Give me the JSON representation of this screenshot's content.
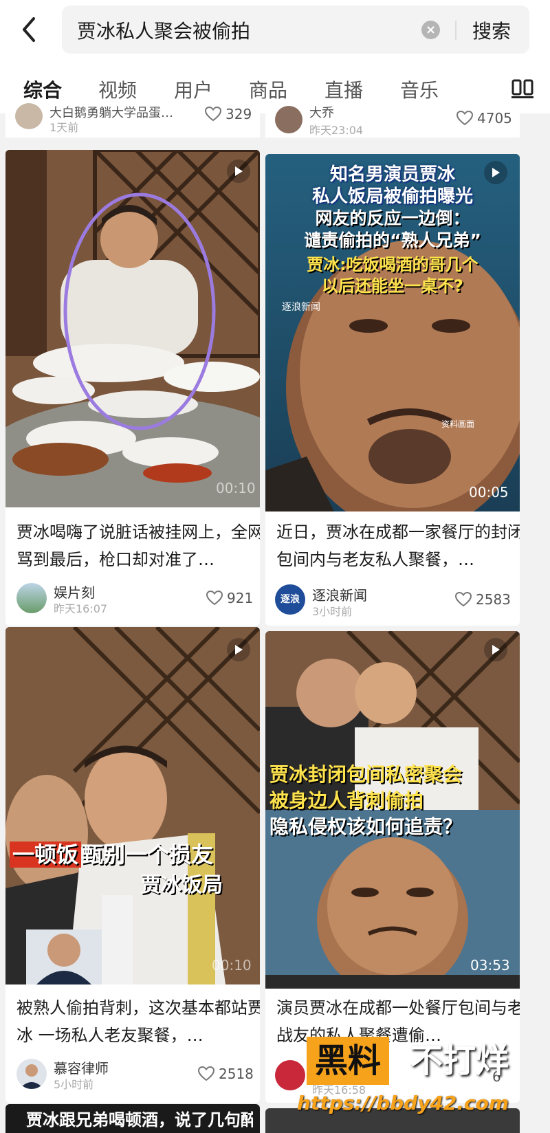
{
  "search": {
    "query": "贾冰私人聚会被偷拍",
    "button": "搜索"
  },
  "tabs": [
    "综合",
    "视频",
    "用户",
    "商品",
    "直播",
    "音乐"
  ],
  "top_partial": [
    {
      "title": "大白鹅勇躺大学品蛋…",
      "time": "1天前",
      "likes": "329"
    },
    {
      "author": "大乔",
      "time": "昨天23:04",
      "likes": "4705"
    }
  ],
  "cards": [
    {
      "duration": "00:10",
      "title": "贾冰喝嗨了说脏话被挂网上，全网骂到最后，枪口却对准了…",
      "author": "娱片刻",
      "time": "昨天16:07",
      "likes": "921"
    },
    {
      "duration": "00:05",
      "overlay": [
        "知名男演员贾冰",
        "私人饭局被偷拍曝光",
        "网友的反应一边倒：",
        "谴责偷拍的“熟人兄弟”",
        "贾冰:吃饭喝酒的哥几个",
        "以后还能坐一桌不?"
      ],
      "source_badge": "逐浪新闻",
      "source_note": "资料画面",
      "title": "近日，贾冰在成都一家餐厅的封闭包间内与老友私人聚餐，…",
      "author": "逐浪新闻",
      "avatar_text": "逐浪",
      "time": "3小时前",
      "likes": "2583"
    },
    {
      "duration": "00:10",
      "overlay": [
        "一顿饭",
        "甄别一个损友",
        "贾冰饭局"
      ],
      "title": "被熟人偷拍背刺，这次基本都站贾冰 一场私人老友聚餐，…",
      "author": "慕容律师",
      "time": "5小时前",
      "likes": "2518"
    },
    {
      "duration": "03:53",
      "overlay": [
        "贾冰封闭包间私密聚会",
        "被身边人背刺偷拍",
        "隐私侵权该如何追责？"
      ],
      "title": "演员贾冰在成都一处餐厅包间与老战友的私人聚餐遭偷…",
      "author": "",
      "time": "昨天16:58",
      "likes": "6"
    }
  ],
  "bottom_partial": {
    "title": "贾冰跟兄弟喝顿酒，说了几句醉话，被人录下来发…"
  },
  "watermark": {
    "line1": "黑料",
    "line2": "不打烊",
    "url": "https://bbdy42.com"
  },
  "colors": {
    "accent_circle": "#9b7be0",
    "watermark_orange": "#f7a21b",
    "overlay_yellow": "#ffe34d"
  }
}
